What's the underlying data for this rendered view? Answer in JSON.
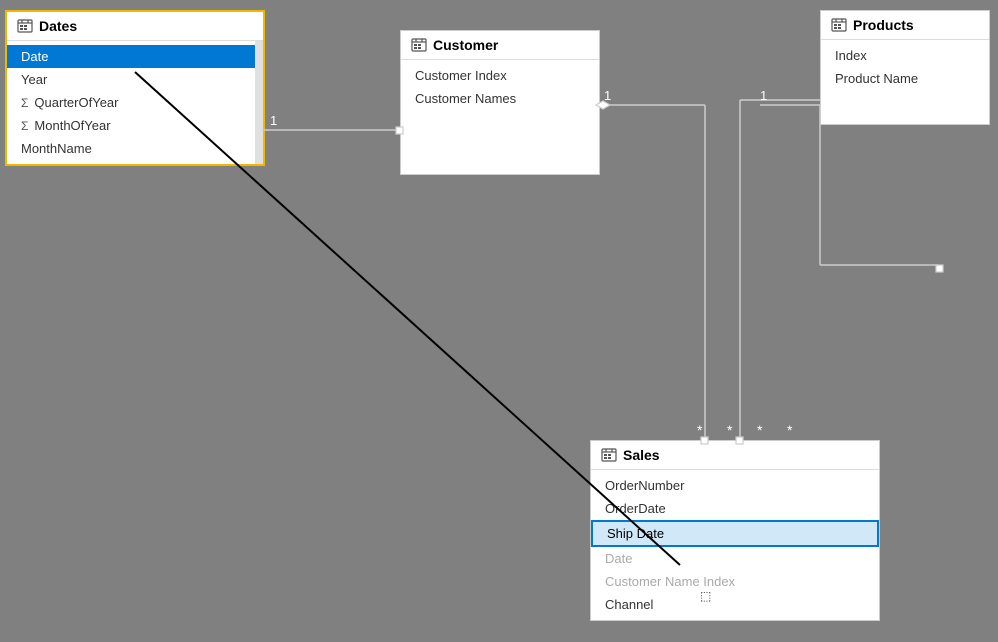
{
  "dates_table": {
    "title": "Dates",
    "rows": [
      {
        "label": "Date",
        "type": "field",
        "selected": true
      },
      {
        "label": "Year",
        "type": "field",
        "selected": false
      },
      {
        "label": "QuarterOfYear",
        "type": "sigma",
        "selected": false
      },
      {
        "label": "MonthOfYear",
        "type": "sigma",
        "selected": false
      },
      {
        "label": "MonthName",
        "type": "field",
        "selected": false
      }
    ]
  },
  "customer_table": {
    "title": "Customer",
    "rows": [
      {
        "label": "Customer Index",
        "type": "field"
      },
      {
        "label": "Customer Names",
        "type": "field"
      }
    ]
  },
  "products_table": {
    "title": "Products",
    "rows": [
      {
        "label": "Index",
        "type": "field"
      },
      {
        "label": "Product Name",
        "type": "field"
      }
    ]
  },
  "sales_table": {
    "title": "Sales",
    "rows": [
      {
        "label": "OrderNumber",
        "type": "field"
      },
      {
        "label": "OrderDate",
        "type": "field"
      },
      {
        "label": "Ship Date",
        "type": "field",
        "selected": true
      },
      {
        "label": "Date",
        "type": "field"
      },
      {
        "label": "Customer Name Index",
        "type": "field"
      },
      {
        "label": "Channel",
        "type": "field"
      }
    ]
  },
  "labels": {
    "one_left": "1",
    "one_right": "1",
    "one_right2": "1",
    "stars": [
      "*",
      "*",
      "*",
      "*"
    ]
  }
}
